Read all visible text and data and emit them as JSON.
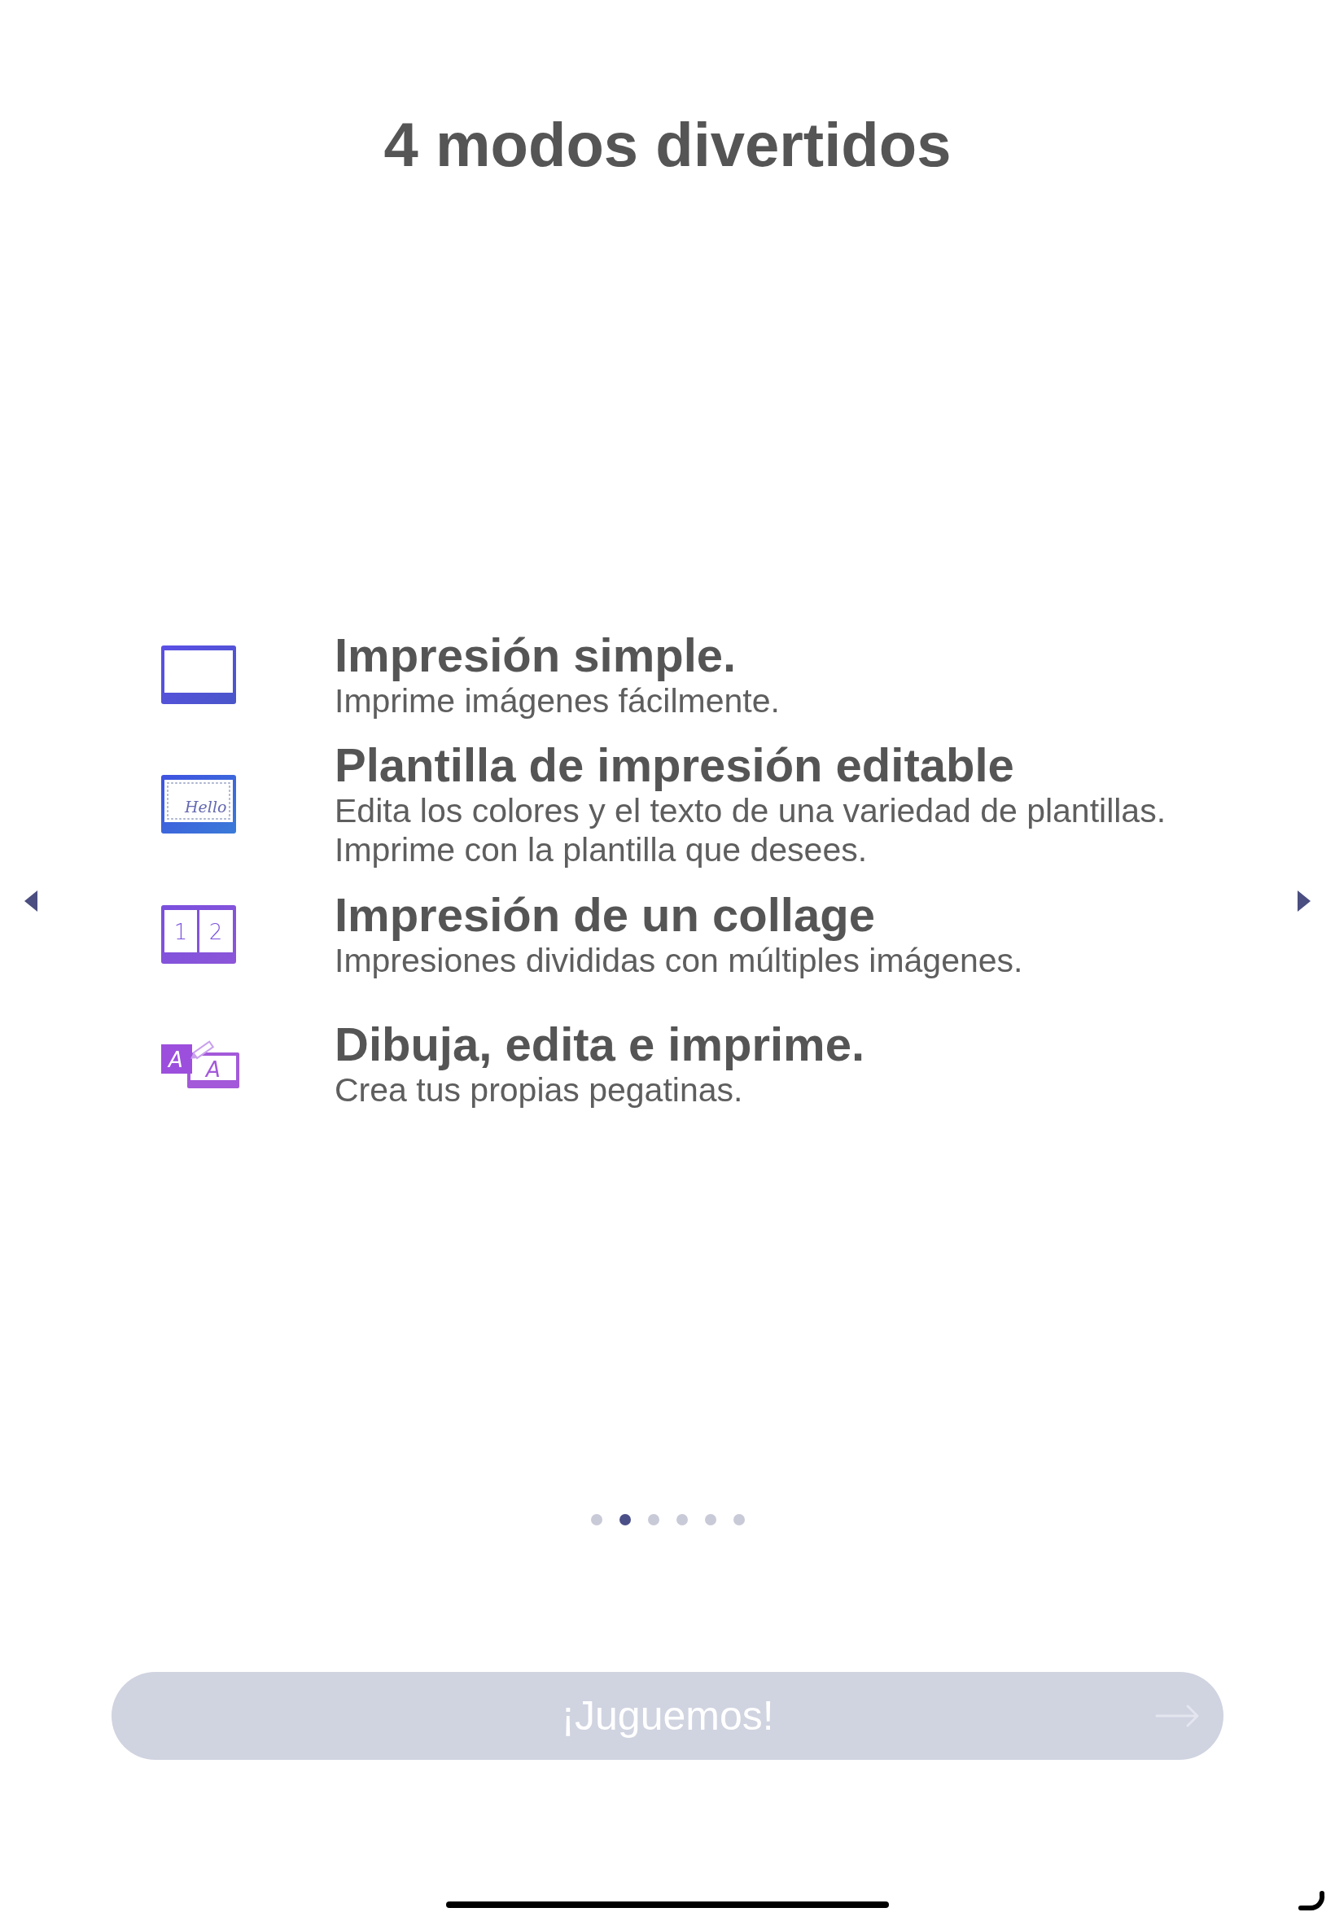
{
  "title": "4 modos divertidos",
  "modes": [
    {
      "kind": "single",
      "heading": "Impresión simple.",
      "lines": [
        "Imprime imágenes fácilmente."
      ]
    },
    {
      "kind": "template",
      "icon_labels": [
        "Hello"
      ],
      "heading": "Plantilla de impresión editable",
      "lines": [
        "Edita los colores y el texto de una variedad de plantillas.",
        "Imprime con la plantilla que desees."
      ]
    },
    {
      "kind": "collage",
      "icon_labels": [
        "1",
        "2"
      ],
      "heading": "Impresión de un collage",
      "lines": [
        "Impresiones divididas con múltiples imágenes."
      ]
    },
    {
      "kind": "draw",
      "icon_labels": [
        "A",
        "A"
      ],
      "heading": "Dibuja, edita e imprime.",
      "lines": [
        "Crea tus propias pegatinas."
      ]
    }
  ],
  "pager": [
    {
      "selected": false
    },
    {
      "selected": true
    },
    {
      "selected": false
    },
    {
      "selected": false
    },
    {
      "selected": false
    },
    {
      "selected": false
    }
  ],
  "play_button": {
    "label": "¡Juguemos!",
    "disabled": true
  }
}
